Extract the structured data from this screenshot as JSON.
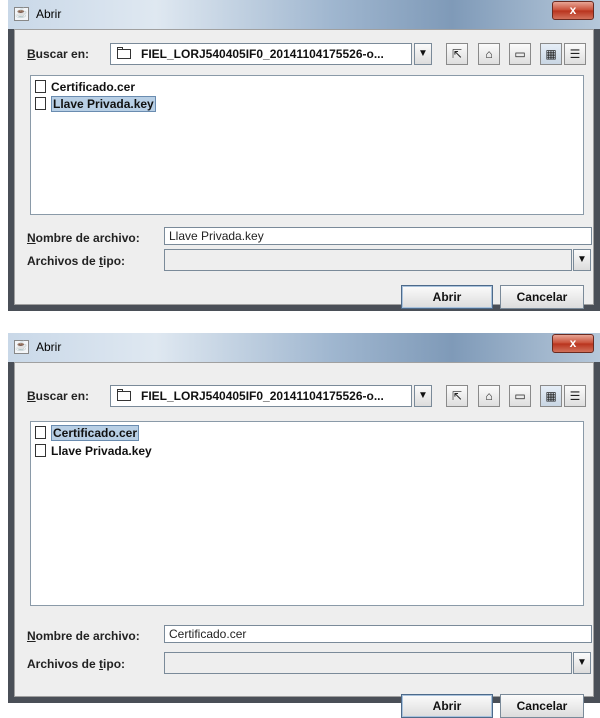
{
  "dialogs": [
    {
      "title": "Abrir",
      "close_glyph": "x",
      "look_in_label": "Buscar en:",
      "look_in_mnemonic": "B",
      "look_in_rest": "uscar en:",
      "look_in_value": "FIEL_LORJ540405IF0_20141104175526-o...",
      "toolbar_icons": [
        "up-folder-icon",
        "home-icon",
        "new-folder-icon",
        "list-view-icon",
        "details-view-icon"
      ],
      "files": [
        {
          "name": "Certificado.cer",
          "selected": false
        },
        {
          "name": "Llave Privada.key",
          "selected": true
        }
      ],
      "filename_label_mnemonic": "N",
      "filename_label_rest": "ombre de archivo:",
      "filename_value": "Llave Privada.key",
      "filetype_label_start": "Archivos de ",
      "filetype_label_mnemonic": "t",
      "filetype_label_rest": "ipo:",
      "filetype_value": "",
      "open_button": "Abrir",
      "cancel_button": "Cancelar"
    },
    {
      "title": "Abrir",
      "close_glyph": "x",
      "look_in_label": "Buscar en:",
      "look_in_mnemonic": "B",
      "look_in_rest": "uscar en:",
      "look_in_value": "FIEL_LORJ540405IF0_20141104175526-o...",
      "toolbar_icons": [
        "up-folder-icon",
        "home-icon",
        "new-folder-icon",
        "list-view-icon",
        "details-view-icon"
      ],
      "files": [
        {
          "name": "Certificado.cer",
          "selected": true
        },
        {
          "name": "Llave Privada.key",
          "selected": false
        }
      ],
      "filename_label_mnemonic": "N",
      "filename_label_rest": "ombre de archivo:",
      "filename_value": "Certificado.cer",
      "filetype_label_start": "Archivos de ",
      "filetype_label_mnemonic": "t",
      "filetype_label_rest": "ipo:",
      "filetype_value": "",
      "open_button": "Abrir",
      "cancel_button": "Cancelar"
    }
  ],
  "colors": {
    "selection": "#b8cfe5",
    "close_button": "#c74a33",
    "dialog_bg": "#eeeeee"
  }
}
